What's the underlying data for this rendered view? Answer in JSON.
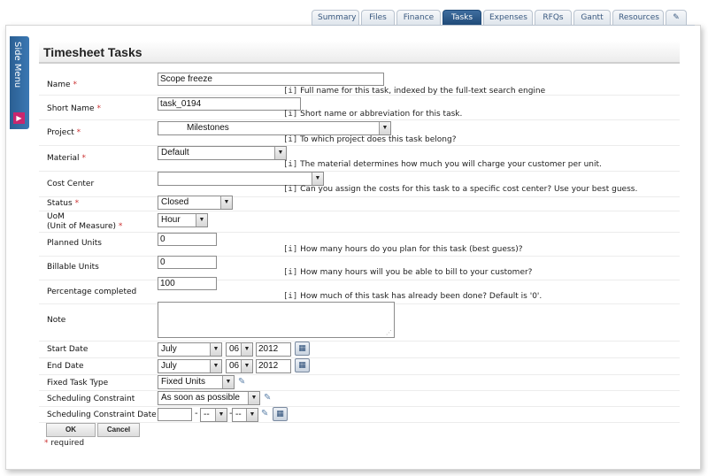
{
  "tabs": [
    {
      "label": "Summary",
      "active": false
    },
    {
      "label": "Files",
      "active": false
    },
    {
      "label": "Finance",
      "active": false
    },
    {
      "label": "Tasks",
      "active": true
    },
    {
      "label": "Expenses",
      "active": false
    },
    {
      "label": "RFQs",
      "active": false
    },
    {
      "label": "Gantt",
      "active": false
    },
    {
      "label": "Resources",
      "active": false
    }
  ],
  "side_menu": {
    "label": "Side Menu"
  },
  "page_title": "Timesheet Tasks",
  "info_marker": "[i]",
  "required_marker": "*",
  "form": {
    "name": {
      "label": "Name",
      "value": "Scope freeze",
      "help": "Full name for this task, indexed by the full-text search engine"
    },
    "short_name": {
      "label": "Short Name",
      "value": "task_0194",
      "help": "Short name or abbreviation for this task."
    },
    "project": {
      "label": "Project",
      "value": "Milestones",
      "help": "To which project does this task belong?"
    },
    "material": {
      "label": "Material",
      "value": "Default",
      "help": "The material determines how much you will charge your customer per unit."
    },
    "cost_center": {
      "label": "Cost Center",
      "value": "",
      "help": "Can you assign the costs for this task to a specific cost center? Use your best guess."
    },
    "status": {
      "label": "Status",
      "value": "Closed"
    },
    "uom": {
      "label_line1": "UoM",
      "label_line2": "(Unit of Measure)",
      "value": "Hour"
    },
    "planned_units": {
      "label": "Planned Units",
      "value": "0",
      "help": "How many hours do you plan for this task (best guess)?"
    },
    "billable_units": {
      "label": "Billable Units",
      "value": "0",
      "help": "How many hours will you be able to bill to your customer?"
    },
    "percentage_completed": {
      "label": "Percentage completed",
      "value": "100",
      "help": "How much of this task has already been done? Default is '0'."
    },
    "note": {
      "label": "Note",
      "value": ""
    },
    "start_date": {
      "label": "Start Date",
      "month": "July",
      "day": "06",
      "year": "2012"
    },
    "end_date": {
      "label": "End Date",
      "month": "July",
      "day": "06",
      "year": "2012"
    },
    "fixed_task_type": {
      "label": "Fixed Task Type",
      "value": "Fixed Units"
    },
    "scheduling_constraint": {
      "label": "Scheduling Constraint",
      "value": "As soon as possible"
    },
    "scheduling_constraint_date": {
      "label": "Scheduling Constraint Date",
      "year": "",
      "month": "--",
      "day": "--"
    }
  },
  "buttons": {
    "ok": "OK",
    "cancel": "Cancel"
  },
  "required_note": "required",
  "icons": {
    "calendar": "calendar-icon",
    "wrench": "wrench-icon",
    "pencil": "pencil-icon",
    "dropdown": "chevron-down-icon"
  }
}
